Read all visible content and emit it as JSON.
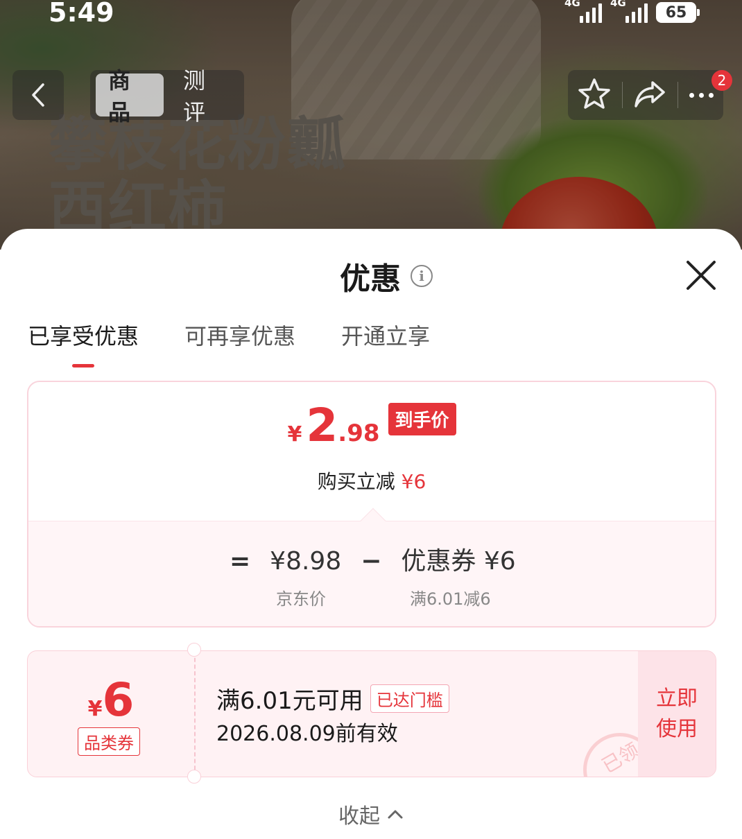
{
  "status_bar": {
    "time": "5:49",
    "network1": "4G",
    "network2": "4G",
    "battery": "65"
  },
  "hero": {
    "title_line1": "攀枝花粉瓤",
    "title_line2": "西红柿"
  },
  "top_nav": {
    "tabs": [
      "商品",
      "测评"
    ],
    "active_tab": "商品",
    "cart_badge": "2"
  },
  "sheet": {
    "title": "优惠",
    "tabs": [
      "已享受优惠",
      "可再享优惠",
      "开通立享"
    ],
    "active_tab": "已享受优惠"
  },
  "price_card": {
    "currency": "¥",
    "price_int": "2",
    "price_dec": ".98",
    "price_tag": "到手价",
    "instant_label": "购买立减 ",
    "instant_value": "¥6",
    "formula": {
      "equals": "=",
      "base_price": "¥8.98",
      "minus": "−",
      "coupon": "优惠券 ¥6",
      "base_label": "京东价",
      "coupon_label": "满6.01减6"
    }
  },
  "coupon": {
    "currency": "¥",
    "amount": "6",
    "type": "品类券",
    "condition": "满6.01元可用",
    "threshold_badge": "已达门槛",
    "expiry": "2026.08.09前有效",
    "use_button": "立即使用",
    "stamp": "已领"
  },
  "collapse_label": "收起",
  "colors": {
    "accent": "#e5343a",
    "card_border": "#f9d4dc",
    "card_bg": "#fff5f7"
  }
}
